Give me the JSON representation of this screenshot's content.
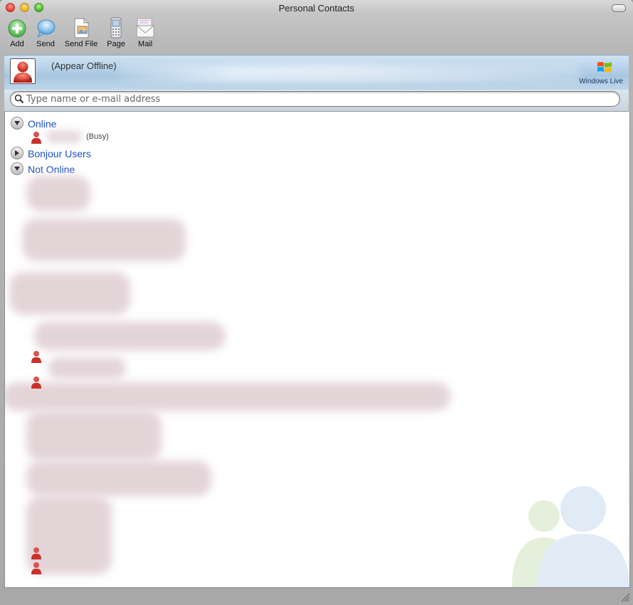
{
  "window": {
    "title": "Personal Contacts"
  },
  "toolbar": {
    "buttons": [
      {
        "label": "Add",
        "icon": "add-icon"
      },
      {
        "label": "Send",
        "icon": "speech-bubble-icon"
      },
      {
        "label": "Send File",
        "icon": "send-file-icon"
      },
      {
        "label": "Page",
        "icon": "mobile-phone-icon"
      },
      {
        "label": "Mail",
        "icon": "mail-icon"
      }
    ]
  },
  "profile": {
    "status": "(Appear Offline)",
    "brand": "Windows Live"
  },
  "search": {
    "placeholder": "Type name or e-mail address"
  },
  "groups": [
    {
      "label": "Online",
      "expanded": true
    },
    {
      "label": "Bonjour Users",
      "expanded": false
    },
    {
      "label": "Not Online",
      "expanded": true
    }
  ],
  "online_contacts": [
    {
      "status": "(Busy)"
    }
  ],
  "colors": {
    "group_label": "#1c4fc7",
    "profile_band": "#a9c7e1"
  }
}
